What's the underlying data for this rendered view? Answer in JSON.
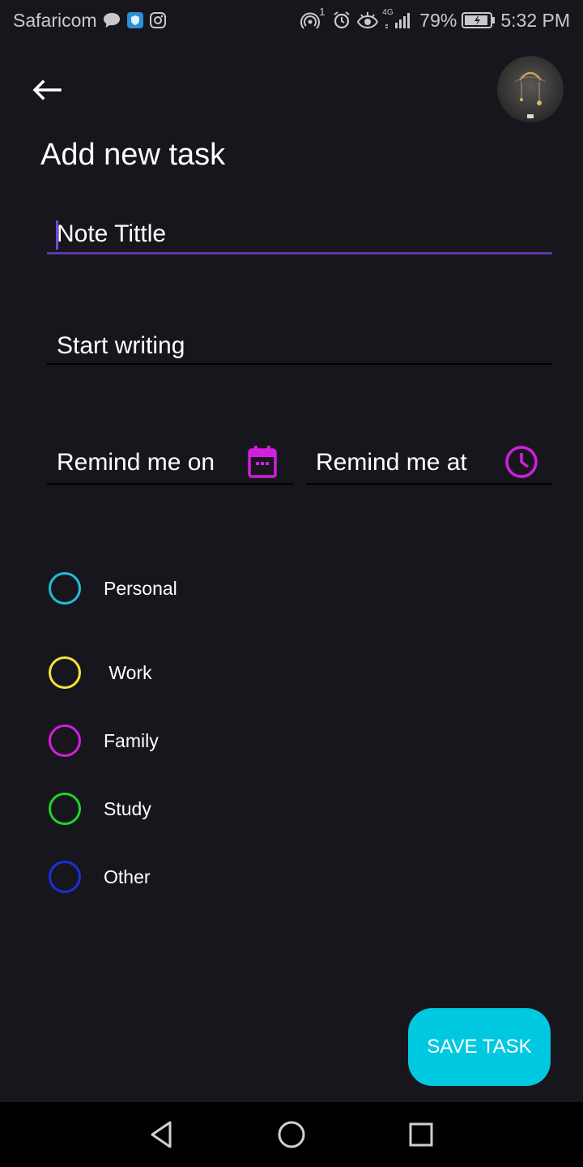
{
  "status_bar": {
    "carrier": "Safaricom",
    "notification_sup": "1",
    "network": "4G",
    "battery": "79%",
    "time": "5:32 PM"
  },
  "header": {
    "back_icon": "arrow-left-icon",
    "avatar": "profile-avatar"
  },
  "page": {
    "title": "Add new task"
  },
  "form": {
    "title_placeholder": "Note Tittle",
    "description_placeholder": "Start writing",
    "date_placeholder": "Remind me on",
    "time_placeholder": "Remind me at",
    "date_icon": "calendar-icon",
    "time_icon": "clock-icon"
  },
  "categories": [
    {
      "label": "Personal",
      "color": "#1ec0d8"
    },
    {
      "label": " Work",
      "color": "#f5e13a"
    },
    {
      "label": "Family",
      "color": "#d21ee0"
    },
    {
      "label": "Study",
      "color": "#1ed42c"
    },
    {
      "label": "Other",
      "color": "#1a2ee0"
    }
  ],
  "actions": {
    "save_label": "SAVE TASK"
  },
  "colors": {
    "background": "#18161d",
    "accent": "#00c8e0",
    "icon_purple": "#d21ee0",
    "focus_underline": "#5a3ba6"
  },
  "nav_bar": {
    "back": "back-triangle-icon",
    "home": "home-circle-icon",
    "recents": "recents-square-icon"
  }
}
